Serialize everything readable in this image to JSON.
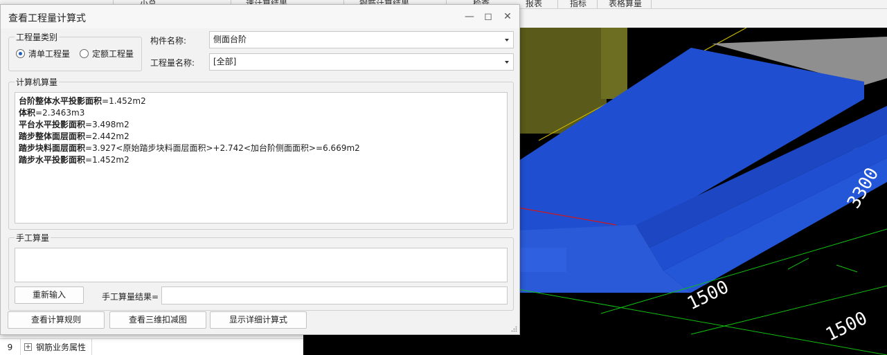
{
  "background": {
    "toolbar_tabs": [
      "小总",
      "速计算结果",
      "钢筋计算结果",
      "检查",
      "报表",
      "指标",
      "表格算量"
    ],
    "property_row": {
      "number": "9",
      "label": "钢筋业务属性"
    },
    "viewport_dimensions": [
      "1500",
      "1500",
      "3300"
    ]
  },
  "dialog": {
    "title": "查看工程量计算式",
    "quantity_type": {
      "legend": "工程量类别",
      "options": [
        "清单工程量",
        "定额工程量"
      ],
      "selected": "清单工程量"
    },
    "component_name": {
      "label": "构件名称:",
      "value": "侧面台阶"
    },
    "quantity_name": {
      "label": "工程量名称:",
      "value": "[全部]"
    },
    "computer_calc": {
      "legend": "计算机算量",
      "lines": [
        {
          "name": "台阶整体水平投影面积",
          "expr": "=1.452m2"
        },
        {
          "name": "体积",
          "expr": "=2.3463m3"
        },
        {
          "name": "平台水平投影面积",
          "expr": "=3.498m2"
        },
        {
          "name": "踏步整体面层面积",
          "expr": "=2.442m2"
        },
        {
          "name": "踏步块料面层面积",
          "expr": "=3.927<原始踏步块料面层面积>+2.742<加台阶侧面面积>=6.669m2"
        },
        {
          "name": "踏步水平投影面积",
          "expr": "=1.452m2"
        }
      ]
    },
    "manual_calc": {
      "legend": "手工算量",
      "reenter_button": "重新输入",
      "result_label": "手工算量结果=",
      "result_value": ""
    },
    "buttons": {
      "view_rules": "查看计算规则",
      "view_3d": "查看三维扣减图",
      "show_detail": "显示详细计算式"
    }
  }
}
